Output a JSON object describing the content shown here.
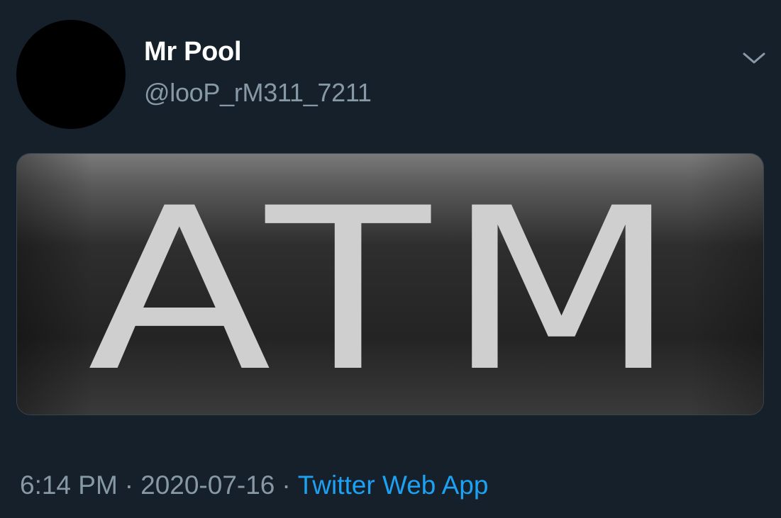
{
  "tweet": {
    "display_name": "Mr Pool",
    "handle": "@looP_rM311_7211",
    "image_text": "ATM",
    "time": "6:14 PM",
    "date": "2020-07-16",
    "separator": "·",
    "source": "Twitter Web App"
  },
  "icons": {
    "menu": "chevron-down-icon"
  },
  "colors": {
    "background": "#15202b",
    "secondary_text": "#8899a6",
    "link": "#1da1f2"
  }
}
